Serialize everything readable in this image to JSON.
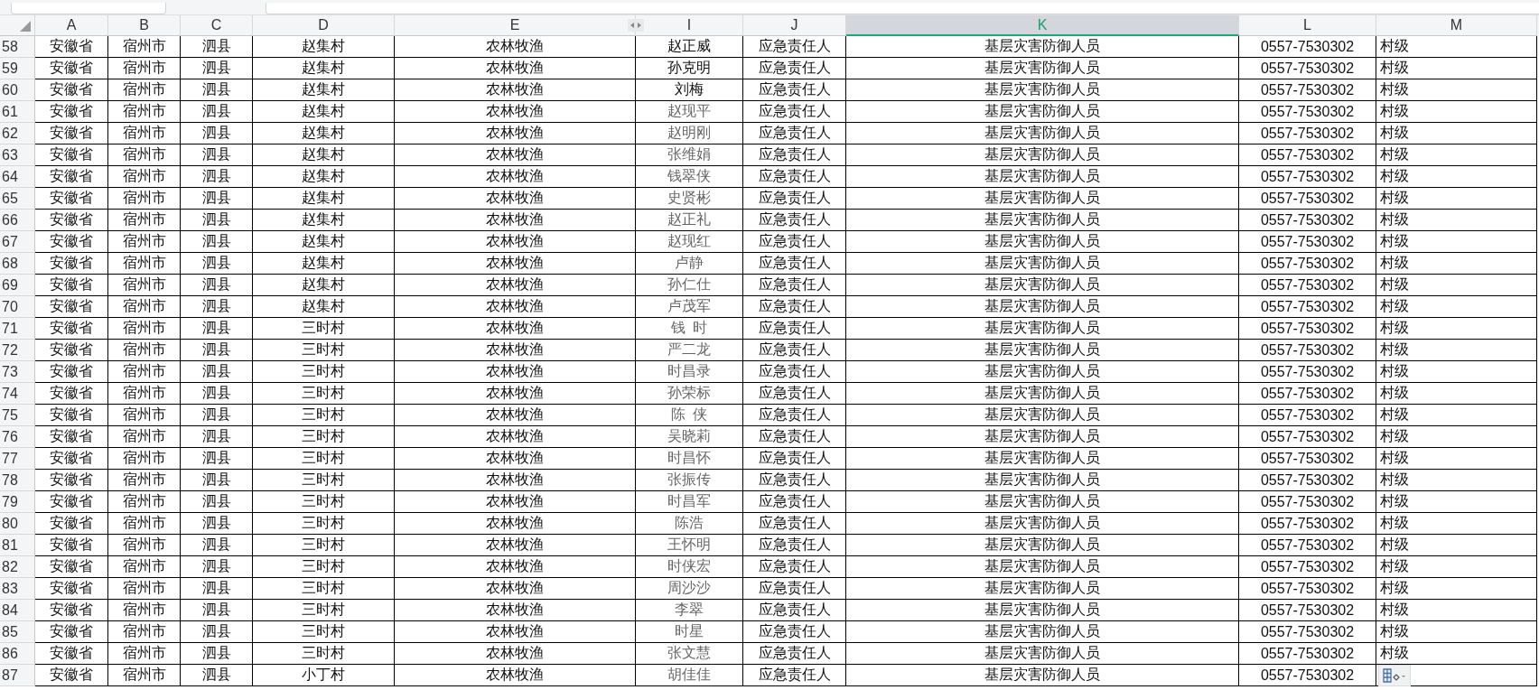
{
  "columns": [
    {
      "label": "A",
      "selected": false
    },
    {
      "label": "B",
      "selected": false
    },
    {
      "label": "C",
      "selected": false
    },
    {
      "label": "D",
      "selected": false
    },
    {
      "label": "E",
      "selected": false
    },
    {
      "label": "I",
      "selected": false
    },
    {
      "label": "J",
      "selected": false
    },
    {
      "label": "K",
      "selected": true
    },
    {
      "label": "L",
      "selected": false
    },
    {
      "label": "M",
      "selected": false
    }
  ],
  "rows": [
    {
      "n": "58",
      "dimmed": false,
      "cells": [
        "安徽省",
        "宿州市",
        "泗县",
        "赵集村",
        "农林牧渔",
        "赵正威",
        "应急责任人",
        "基层灾害防御人员",
        "0557-7530302",
        "村级"
      ]
    },
    {
      "n": "59",
      "dimmed": false,
      "cells": [
        "安徽省",
        "宿州市",
        "泗县",
        "赵集村",
        "农林牧渔",
        "孙克明",
        "应急责任人",
        "基层灾害防御人员",
        "0557-7530302",
        "村级"
      ]
    },
    {
      "n": "60",
      "dimmed": false,
      "cells": [
        "安徽省",
        "宿州市",
        "泗县",
        "赵集村",
        "农林牧渔",
        "刘梅",
        "应急责任人",
        "基层灾害防御人员",
        "0557-7530302",
        "村级"
      ]
    },
    {
      "n": "61",
      "dimmed": true,
      "cells": [
        "安徽省",
        "宿州市",
        "泗县",
        "赵集村",
        "农林牧渔",
        "赵现平",
        "应急责任人",
        "基层灾害防御人员",
        "0557-7530302",
        "村级"
      ]
    },
    {
      "n": "62",
      "dimmed": true,
      "cells": [
        "安徽省",
        "宿州市",
        "泗县",
        "赵集村",
        "农林牧渔",
        "赵明刚",
        "应急责任人",
        "基层灾害防御人员",
        "0557-7530302",
        "村级"
      ]
    },
    {
      "n": "63",
      "dimmed": true,
      "cells": [
        "安徽省",
        "宿州市",
        "泗县",
        "赵集村",
        "农林牧渔",
        "张维娟",
        "应急责任人",
        "基层灾害防御人员",
        "0557-7530302",
        "村级"
      ]
    },
    {
      "n": "64",
      "dimmed": true,
      "cells": [
        "安徽省",
        "宿州市",
        "泗县",
        "赵集村",
        "农林牧渔",
        "钱翠侠",
        "应急责任人",
        "基层灾害防御人员",
        "0557-7530302",
        "村级"
      ]
    },
    {
      "n": "65",
      "dimmed": true,
      "cells": [
        "安徽省",
        "宿州市",
        "泗县",
        "赵集村",
        "农林牧渔",
        "史贤彬",
        "应急责任人",
        "基层灾害防御人员",
        "0557-7530302",
        "村级"
      ]
    },
    {
      "n": "66",
      "dimmed": true,
      "cells": [
        "安徽省",
        "宿州市",
        "泗县",
        "赵集村",
        "农林牧渔",
        "赵正礼",
        "应急责任人",
        "基层灾害防御人员",
        "0557-7530302",
        "村级"
      ]
    },
    {
      "n": "67",
      "dimmed": true,
      "cells": [
        "安徽省",
        "宿州市",
        "泗县",
        "赵集村",
        "农林牧渔",
        "赵现红",
        "应急责任人",
        "基层灾害防御人员",
        "0557-7530302",
        "村级"
      ]
    },
    {
      "n": "68",
      "dimmed": true,
      "cells": [
        "安徽省",
        "宿州市",
        "泗县",
        "赵集村",
        "农林牧渔",
        "卢静",
        "应急责任人",
        "基层灾害防御人员",
        "0557-7530302",
        "村级"
      ]
    },
    {
      "n": "69",
      "dimmed": true,
      "cells": [
        "安徽省",
        "宿州市",
        "泗县",
        "赵集村",
        "农林牧渔",
        "孙仁仕",
        "应急责任人",
        "基层灾害防御人员",
        "0557-7530302",
        "村级"
      ]
    },
    {
      "n": "70",
      "dimmed": true,
      "cells": [
        "安徽省",
        "宿州市",
        "泗县",
        "赵集村",
        "农林牧渔",
        "卢茂军",
        "应急责任人",
        "基层灾害防御人员",
        "0557-7530302",
        "村级"
      ]
    },
    {
      "n": "71",
      "dimmed": true,
      "cells": [
        "安徽省",
        "宿州市",
        "泗县",
        "三时村",
        "农林牧渔",
        "钱  时",
        "应急责任人",
        "基层灾害防御人员",
        "0557-7530302",
        "村级"
      ]
    },
    {
      "n": "72",
      "dimmed": true,
      "cells": [
        "安徽省",
        "宿州市",
        "泗县",
        "三时村",
        "农林牧渔",
        "严二龙",
        "应急责任人",
        "基层灾害防御人员",
        "0557-7530302",
        "村级"
      ]
    },
    {
      "n": "73",
      "dimmed": true,
      "cells": [
        "安徽省",
        "宿州市",
        "泗县",
        "三时村",
        "农林牧渔",
        "时昌录",
        "应急责任人",
        "基层灾害防御人员",
        "0557-7530302",
        "村级"
      ]
    },
    {
      "n": "74",
      "dimmed": true,
      "cells": [
        "安徽省",
        "宿州市",
        "泗县",
        "三时村",
        "农林牧渔",
        "孙荣标",
        "应急责任人",
        "基层灾害防御人员",
        "0557-7530302",
        "村级"
      ]
    },
    {
      "n": "75",
      "dimmed": true,
      "cells": [
        "安徽省",
        "宿州市",
        "泗县",
        "三时村",
        "农林牧渔",
        "陈  侠",
        "应急责任人",
        "基层灾害防御人员",
        "0557-7530302",
        "村级"
      ]
    },
    {
      "n": "76",
      "dimmed": true,
      "cells": [
        "安徽省",
        "宿州市",
        "泗县",
        "三时村",
        "农林牧渔",
        "吴晓莉",
        "应急责任人",
        "基层灾害防御人员",
        "0557-7530302",
        "村级"
      ]
    },
    {
      "n": "77",
      "dimmed": true,
      "cells": [
        "安徽省",
        "宿州市",
        "泗县",
        "三时村",
        "农林牧渔",
        "时昌怀",
        "应急责任人",
        "基层灾害防御人员",
        "0557-7530302",
        "村级"
      ]
    },
    {
      "n": "78",
      "dimmed": true,
      "cells": [
        "安徽省",
        "宿州市",
        "泗县",
        "三时村",
        "农林牧渔",
        "张振传",
        "应急责任人",
        "基层灾害防御人员",
        "0557-7530302",
        "村级"
      ]
    },
    {
      "n": "79",
      "dimmed": true,
      "cells": [
        "安徽省",
        "宿州市",
        "泗县",
        "三时村",
        "农林牧渔",
        "时昌军",
        "应急责任人",
        "基层灾害防御人员",
        "0557-7530302",
        "村级"
      ]
    },
    {
      "n": "80",
      "dimmed": true,
      "cells": [
        "安徽省",
        "宿州市",
        "泗县",
        "三时村",
        "农林牧渔",
        "陈浩",
        "应急责任人",
        "基层灾害防御人员",
        "0557-7530302",
        "村级"
      ]
    },
    {
      "n": "81",
      "dimmed": true,
      "cells": [
        "安徽省",
        "宿州市",
        "泗县",
        "三时村",
        "农林牧渔",
        "王怀明",
        "应急责任人",
        "基层灾害防御人员",
        "0557-7530302",
        "村级"
      ]
    },
    {
      "n": "82",
      "dimmed": true,
      "cells": [
        "安徽省",
        "宿州市",
        "泗县",
        "三时村",
        "农林牧渔",
        "时侠宏",
        "应急责任人",
        "基层灾害防御人员",
        "0557-7530302",
        "村级"
      ]
    },
    {
      "n": "83",
      "dimmed": true,
      "cells": [
        "安徽省",
        "宿州市",
        "泗县",
        "三时村",
        "农林牧渔",
        "周沙沙",
        "应急责任人",
        "基层灾害防御人员",
        "0557-7530302",
        "村级"
      ]
    },
    {
      "n": "84",
      "dimmed": true,
      "cells": [
        "安徽省",
        "宿州市",
        "泗县",
        "三时村",
        "农林牧渔",
        "李翠",
        "应急责任人",
        "基层灾害防御人员",
        "0557-7530302",
        "村级"
      ]
    },
    {
      "n": "85",
      "dimmed": true,
      "cells": [
        "安徽省",
        "宿州市",
        "泗县",
        "三时村",
        "农林牧渔",
        "时星",
        "应急责任人",
        "基层灾害防御人员",
        "0557-7530302",
        "村级"
      ]
    },
    {
      "n": "86",
      "dimmed": true,
      "cells": [
        "安徽省",
        "宿州市",
        "泗县",
        "三时村",
        "农林牧渔",
        "张文慧",
        "应急责任人",
        "基层灾害防御人员",
        "0557-7530302",
        "村级"
      ]
    },
    {
      "n": "87",
      "dimmed": true,
      "cells": [
        "安徽省",
        "宿州市",
        "泗县",
        "小丁村",
        "农林牧渔",
        "胡佳佳",
        "应急责任人",
        "基层灾害防御人员",
        "0557-7530302"
      ]
    }
  ],
  "paste_options": true
}
